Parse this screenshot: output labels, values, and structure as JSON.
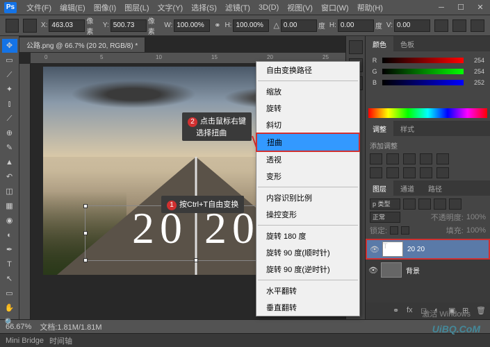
{
  "menu": [
    "文件(F)",
    "编辑(E)",
    "图像(I)",
    "图层(L)",
    "文字(Y)",
    "选择(S)",
    "滤镜(T)",
    "3D(D)",
    "视图(V)",
    "窗口(W)",
    "帮助(H)"
  ],
  "options": {
    "x_label": "X:",
    "x": "463.03",
    "x_unit": "像素",
    "y_label": "Y:",
    "y": "500.73",
    "y_unit": "像素",
    "w_label": "W:",
    "w": "100.00%",
    "h_label": "H:",
    "h": "100.00%",
    "angle": "0.00",
    "angle_unit": "度",
    "hskew_label": "H:",
    "hskew": "0.00",
    "hskew_unit": "度",
    "vskew_label": "V:",
    "vskew": "0.00"
  },
  "doc_tab": "公路.png @ 66.7% (20 20, RGB/8) *",
  "ruler_marks": [
    "0",
    "5",
    "10",
    "15",
    "20",
    "25"
  ],
  "tips": {
    "t1_num": "1",
    "t1": "按Ctrl+T自由变换",
    "t2_num": "2",
    "t2a": "点击鼠标右键",
    "t2b": "选择扭曲"
  },
  "canvas_text": "20 20",
  "ctx": {
    "free": "自由变换路径",
    "scale": "缩放",
    "rotate": "旋转",
    "skew": "斜切",
    "distort": "扭曲",
    "perspective": "透视",
    "warp": "变形",
    "content": "内容识别比例",
    "puppet": "操控变形",
    "r180": "旋转 180 度",
    "r90cw": "旋转 90 度(顺时针)",
    "r90ccw": "旋转 90 度(逆时针)",
    "fliph": "水平翻转",
    "flipv": "垂直翻转"
  },
  "color_panel": {
    "tab1": "颜色",
    "tab2": "色板",
    "r": "R",
    "rv": "254",
    "g": "G",
    "gv": "254",
    "b": "B",
    "bv": "252"
  },
  "adjust": {
    "tab1": "调整",
    "tab2": "样式",
    "label": "添加调整"
  },
  "layers": {
    "tab1": "图层",
    "tab2": "通道",
    "tab3": "路径",
    "kind": "p 类型",
    "mode": "正常",
    "opacity_label": "不透明度:",
    "opacity": "100%",
    "lock": "锁定:",
    "fill_label": "填充:",
    "fill": "100%",
    "l1": "20 20",
    "l2": "背景"
  },
  "status": {
    "zoom": "66.67%",
    "doc": "文档:1.81M/1.81M"
  },
  "bottom": {
    "t1": "Mini Bridge",
    "t2": "时间轴"
  },
  "watermark": "激活 Windows",
  "brand": "UiBQ.CoM"
}
